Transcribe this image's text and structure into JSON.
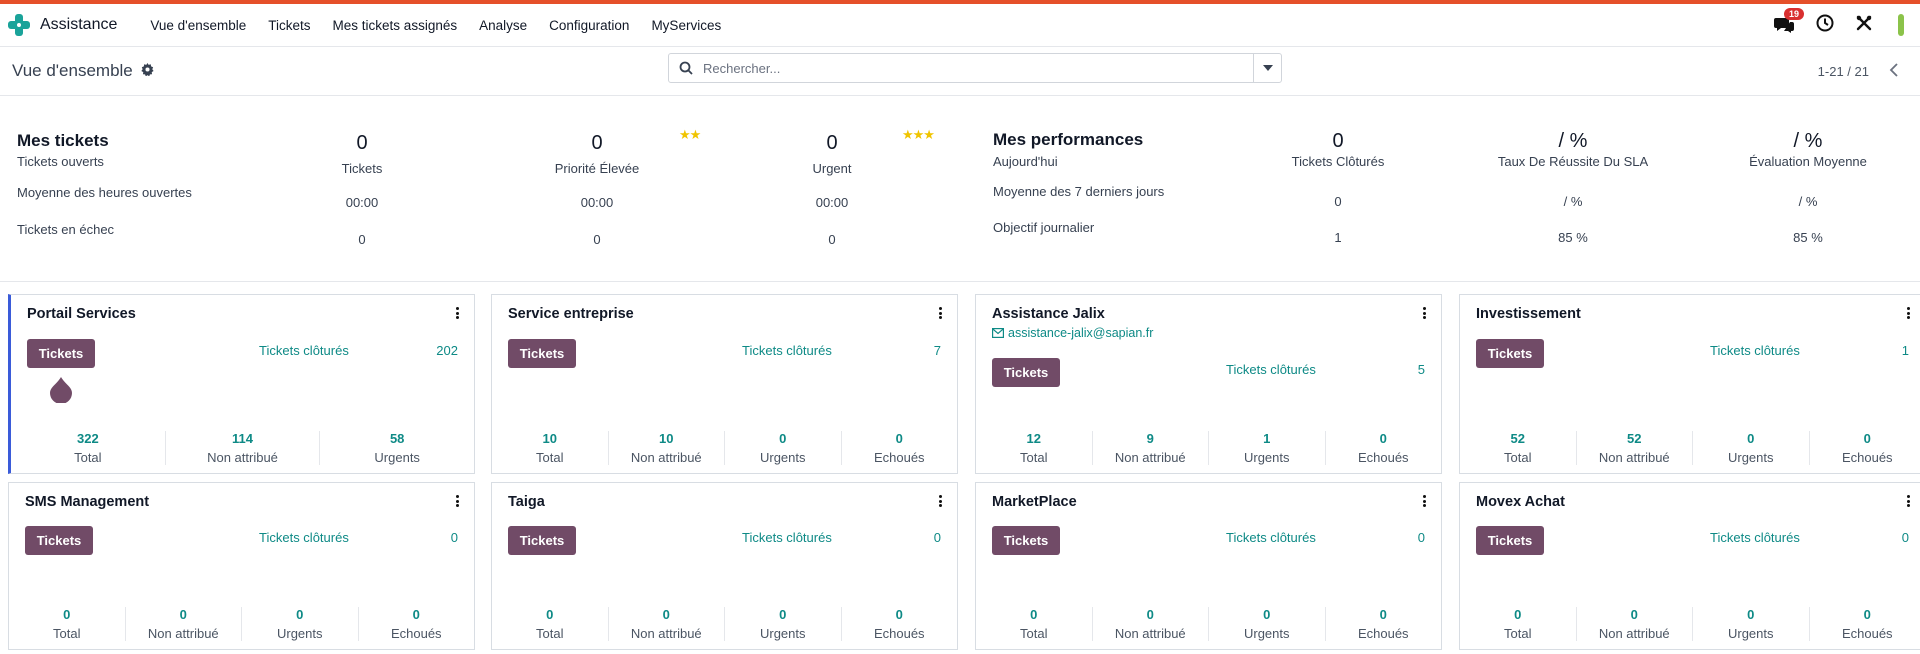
{
  "app": {
    "name": "Assistance"
  },
  "nav": {
    "items": [
      "Vue d'ensemble",
      "Tickets",
      "Mes tickets assignés",
      "Analyse",
      "Configuration",
      "MyServices"
    ],
    "notif_count": "19"
  },
  "control": {
    "title": "Vue d'ensemble",
    "search_placeholder": "Rechercher...",
    "pager": "1-21 / 21"
  },
  "stats": {
    "mine": {
      "heading": "Mes tickets",
      "rows": [
        "Tickets ouverts",
        "Moyenne des heures ouvertes",
        "Tickets en échec"
      ],
      "cols": [
        {
          "top": "0",
          "label": "Tickets",
          "avg": "00:00",
          "fail": "0"
        },
        {
          "top": "0",
          "label": "Priorité Élevée",
          "avg": "00:00",
          "fail": "0"
        },
        {
          "top": "0",
          "label": "Urgent",
          "avg": "00:00",
          "fail": "0"
        }
      ],
      "stars": [
        "★★",
        "★★★"
      ]
    },
    "perf": {
      "heading": "Mes performances",
      "rows": [
        "Aujourd'hui",
        "Moyenne des 7 derniers jours",
        "Objectif journalier"
      ],
      "cols": [
        {
          "top": "0",
          "label": "Tickets Clôturés",
          "avg": "0",
          "goal": "1"
        },
        {
          "top": "/ %",
          "label": "Taux De Réussite Du SLA",
          "avg": "/ %",
          "goal": "85 %"
        },
        {
          "top": "/ %",
          "label": "Évaluation Moyenne",
          "avg": "/ %",
          "goal": "85 %"
        }
      ]
    }
  },
  "card_labels": {
    "button": "Tickets",
    "closed": "Tickets clôturés",
    "total": "Total",
    "unassigned": "Non attribué",
    "urgent": "Urgents",
    "failed": "Echoués"
  },
  "cards": [
    {
      "name": "Portail Services",
      "closed": "202",
      "total": "322",
      "unassigned": "114",
      "urgent": "58",
      "failed": null
    },
    {
      "name": "Service entreprise",
      "closed": "7",
      "total": "10",
      "unassigned": "10",
      "urgent": "0",
      "failed": "0"
    },
    {
      "name": "Assistance Jalix",
      "email": "assistance-jalix@sapian.fr",
      "closed": "5",
      "total": "12",
      "unassigned": "9",
      "urgent": "1",
      "failed": "0"
    },
    {
      "name": "Investissement",
      "closed": "1",
      "total": "52",
      "unassigned": "52",
      "urgent": "0",
      "failed": "0"
    },
    {
      "name": "SMS Management",
      "closed": "0",
      "total": "0",
      "unassigned": "0",
      "urgent": "0",
      "failed": "0"
    },
    {
      "name": "Taiga",
      "closed": "0",
      "total": "0",
      "unassigned": "0",
      "urgent": "0",
      "failed": "0"
    },
    {
      "name": "MarketPlace",
      "closed": "0",
      "total": "0",
      "unassigned": "0",
      "urgent": "0",
      "failed": "0"
    },
    {
      "name": "Movex Achat",
      "closed": "0",
      "total": "0",
      "unassigned": "0",
      "urgent": "0",
      "failed": "0"
    }
  ],
  "colors": {
    "accent": "#714b67",
    "teal": "#0e8a86",
    "active_border": "#3a5bd9",
    "topbar": "#e5502a"
  }
}
